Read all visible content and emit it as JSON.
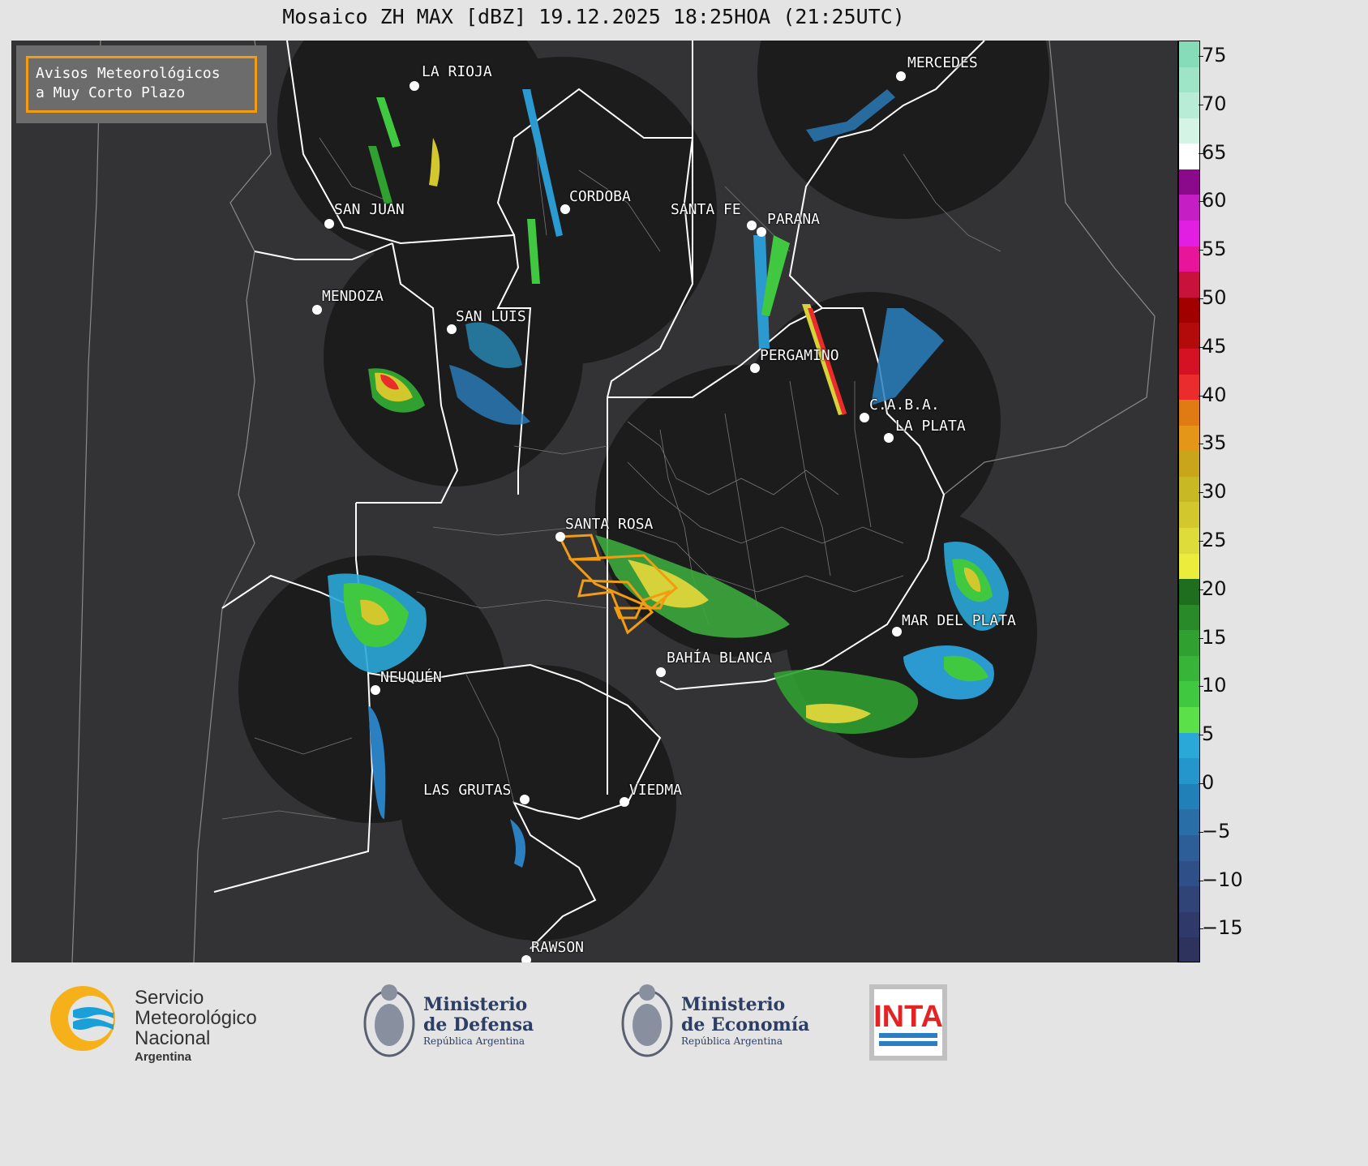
{
  "title": "Mosaico ZH MAX [dBZ] 19.12.2025 18:25HOA (21:25UTC)",
  "warning_box": {
    "line1": "Avisos Meteorológicos",
    "line2": "a Muy Corto Plazo",
    "border_color": "#f39c12"
  },
  "cities": [
    {
      "id": "la-rioja",
      "name": "LA RIOJA"
    },
    {
      "id": "san-juan",
      "name": "SAN JUAN"
    },
    {
      "id": "cordoba",
      "name": "CORDOBA"
    },
    {
      "id": "santa-fe",
      "name": "SANTA FE"
    },
    {
      "id": "parana",
      "name": "PARANA"
    },
    {
      "id": "mercedes",
      "name": "MERCEDES"
    },
    {
      "id": "mendoza",
      "name": "MENDOZA"
    },
    {
      "id": "san-luis",
      "name": "SAN LUIS"
    },
    {
      "id": "pergamino",
      "name": "PERGAMINO"
    },
    {
      "id": "caba",
      "name": "C.A.B.A."
    },
    {
      "id": "la-plata",
      "name": "LA PLATA"
    },
    {
      "id": "santa-rosa",
      "name": "SANTA ROSA"
    },
    {
      "id": "mar-del-plata",
      "name": "MAR DEL PLATA"
    },
    {
      "id": "bahia-blanca",
      "name": "BAHÍA BLANCA"
    },
    {
      "id": "neuquen",
      "name": "NEUQUÉN"
    },
    {
      "id": "las-grutas",
      "name": "LAS GRUTAS"
    },
    {
      "id": "viedma",
      "name": "VIEDMA"
    },
    {
      "id": "rawson",
      "name": "RAWSON"
    }
  ],
  "colorbar": {
    "ticks": [
      "75",
      "70",
      "65",
      "60",
      "55",
      "50",
      "45",
      "40",
      "35",
      "30",
      "25",
      "20",
      "15",
      "10",
      "5",
      "0",
      "−5",
      "−10",
      "−15"
    ],
    "colors": [
      "#86dcb8",
      "#9ee4c6",
      "#b8ecd6",
      "#d4f4e6",
      "#ffffff",
      "#8b0a8b",
      "#c41ec4",
      "#e31ee3",
      "#e8159a",
      "#c8123c",
      "#a00000",
      "#b30b0b",
      "#d41224",
      "#ea2c2c",
      "#e07a12",
      "#e49618",
      "#c9a51b",
      "#c8b924",
      "#d2c82e",
      "#dedc3a",
      "#ecec3c",
      "#1f6e1f",
      "#288a28",
      "#30a030",
      "#38b438",
      "#40c840",
      "#5ce04a",
      "#2aa8d8",
      "#2496cc",
      "#2280b8",
      "#2a6ea8",
      "#2d5e98",
      "#2f4f88",
      "#304478",
      "#303a6a",
      "#2e335e"
    ]
  },
  "footer": {
    "smn_line1": "Servicio",
    "smn_line2": "Meteorológico",
    "smn_line3": "Nacional",
    "smn_line4": "Argentina",
    "defensa_line1": "Ministerio",
    "defensa_line2": "de Defensa",
    "defensa_line3": "República Argentina",
    "economia_line1": "Ministerio",
    "economia_line2": "de Economía",
    "economia_line3": "República Argentina",
    "inta": "INTA"
  }
}
